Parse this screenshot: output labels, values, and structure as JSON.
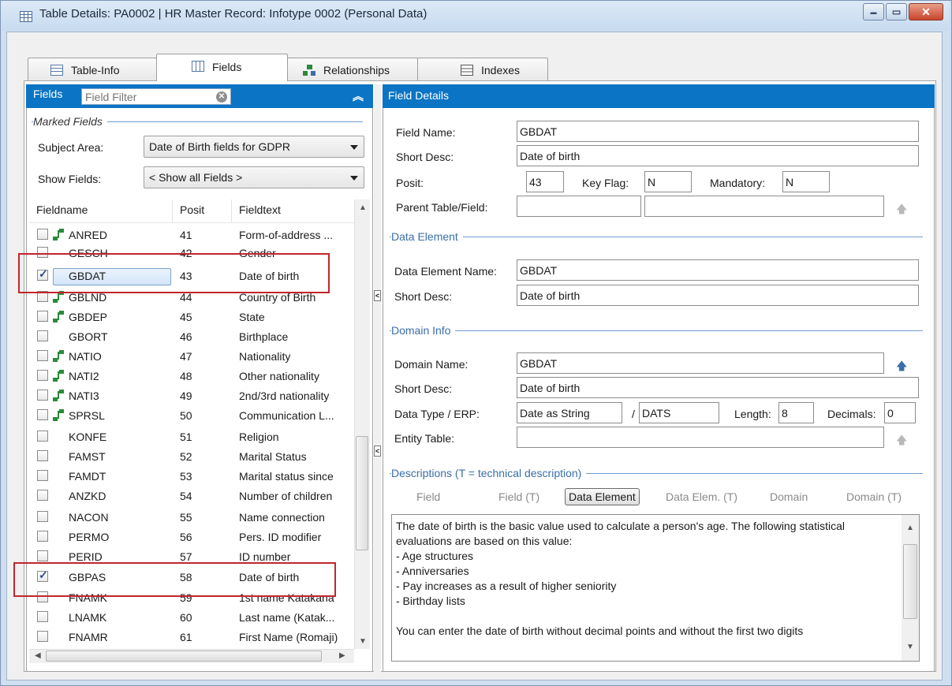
{
  "window": {
    "title": "Table Details: PA0002 | HR Master Record: Infotype 0002 (Personal Data)",
    "controls": {
      "minimize": "▬",
      "maximize": "▭",
      "close": "✕"
    }
  },
  "tabs": [
    {
      "label": "Table-Info",
      "icon": "table-icon",
      "active": false
    },
    {
      "label": "Fields",
      "icon": "columns-icon",
      "active": true
    },
    {
      "label": "Relationships",
      "icon": "hierarchy-icon",
      "active": false
    },
    {
      "label": "Indexes",
      "icon": "index-icon",
      "active": false
    }
  ],
  "fields_panel": {
    "header_label": "Fields",
    "filter_placeholder": "Field Filter",
    "marked_fields_label": "Marked Fields",
    "subject_area_label": "Subject Area:",
    "subject_area_value": "Date of Birth fields for GDPR",
    "show_fields_label": "Show Fields:",
    "show_fields_value": "< Show all Fields >",
    "columns": [
      "Fieldname",
      "Posit",
      "Fieldtext"
    ],
    "rows": [
      {
        "checked": false,
        "key": true,
        "name": "ANRED",
        "posit": "41",
        "text": "Form-of-address ..."
      },
      {
        "checked": false,
        "key": false,
        "name": "GESCH",
        "posit": "42",
        "text": "Gender"
      },
      {
        "checked": true,
        "key": false,
        "name": "GBDAT",
        "posit": "43",
        "text": "Date of birth",
        "selected": true
      },
      {
        "checked": false,
        "key": true,
        "name": "GBLND",
        "posit": "44",
        "text": "Country of Birth"
      },
      {
        "checked": false,
        "key": true,
        "name": "GBDEP",
        "posit": "45",
        "text": "State"
      },
      {
        "checked": false,
        "key": false,
        "name": "GBORT",
        "posit": "46",
        "text": "Birthplace"
      },
      {
        "checked": false,
        "key": true,
        "name": "NATIO",
        "posit": "47",
        "text": "Nationality"
      },
      {
        "checked": false,
        "key": true,
        "name": "NATI2",
        "posit": "48",
        "text": "Other nationality"
      },
      {
        "checked": false,
        "key": true,
        "name": "NATI3",
        "posit": "49",
        "text": "2nd/3rd nationality"
      },
      {
        "checked": false,
        "key": true,
        "name": "SPRSL",
        "posit": "50",
        "text": "Communication L..."
      },
      {
        "checked": false,
        "key": false,
        "name": "KONFE",
        "posit": "51",
        "text": "Religion"
      },
      {
        "checked": false,
        "key": false,
        "name": "FAMST",
        "posit": "52",
        "text": "Marital Status"
      },
      {
        "checked": false,
        "key": false,
        "name": "FAMDT",
        "posit": "53",
        "text": "Marital status since"
      },
      {
        "checked": false,
        "key": false,
        "name": "ANZKD",
        "posit": "54",
        "text": "Number of children"
      },
      {
        "checked": false,
        "key": false,
        "name": "NACON",
        "posit": "55",
        "text": "Name connection"
      },
      {
        "checked": false,
        "key": false,
        "name": "PERMO",
        "posit": "56",
        "text": "Pers. ID modifier"
      },
      {
        "checked": false,
        "key": false,
        "name": "PERID",
        "posit": "57",
        "text": "ID number"
      },
      {
        "checked": true,
        "key": false,
        "name": "GBPAS",
        "posit": "58",
        "text": "Date of birth"
      },
      {
        "checked": false,
        "key": false,
        "name": "FNAMK",
        "posit": "59",
        "text": "1st name Katakana"
      },
      {
        "checked": false,
        "key": false,
        "name": "LNAMK",
        "posit": "60",
        "text": "Last name (Katak..."
      },
      {
        "checked": false,
        "key": false,
        "name": "FNAMR",
        "posit": "61",
        "text": "First Name (Romaji)"
      }
    ]
  },
  "details": {
    "header": "Field Details",
    "field_name_label": "Field Name:",
    "field_name": "GBDAT",
    "short_desc_label": "Short Desc:",
    "short_desc": "Date of birth",
    "posit_label": "Posit:",
    "posit": "43",
    "key_flag_label": "Key Flag:",
    "key_flag": "N",
    "mandatory_label": "Mandatory:",
    "mandatory": "N",
    "parent_label": "Parent Table/Field:",
    "parent_table": "",
    "parent_field": "",
    "data_element_group": "Data Element",
    "de_name_label": "Data Element Name:",
    "de_name": "GBDAT",
    "de_short_label": "Short Desc:",
    "de_short": "Date of birth",
    "domain_group": "Domain Info",
    "dom_name_label": "Domain Name:",
    "dom_name": "GBDAT",
    "dom_short_label": "Short Desc:",
    "dom_short": "Date of birth",
    "dtype_label": "Data Type / ERP:",
    "dtype": "Date as String",
    "slash": "/",
    "erp": "DATS",
    "length_label": "Length:",
    "length": "8",
    "decimals_label": "Decimals:",
    "decimals": "0",
    "entity_label": "Entity Table:",
    "entity": "",
    "descriptions_group": "Descriptions  (T = technical description)",
    "desc_tabs": [
      "Field",
      "Field (T)",
      "Data Element",
      "Data Elem. (T)",
      "Domain",
      "Domain (T)"
    ],
    "desc_active": "Data Element",
    "desc_text": "The date of birth is the basic value used to calculate a person's age. The following statistical evaluations are based on this value:\n- Age structures\n- Anniversaries\n- Pay increases as a result of higher seniority\n- Birthday lists\n\nYou can enter the date of birth without decimal points and without the first two digits"
  },
  "colors": {
    "accent": "#0B74C4",
    "highlight_box": "#C0262C",
    "group_label": "#3A6EA8"
  }
}
